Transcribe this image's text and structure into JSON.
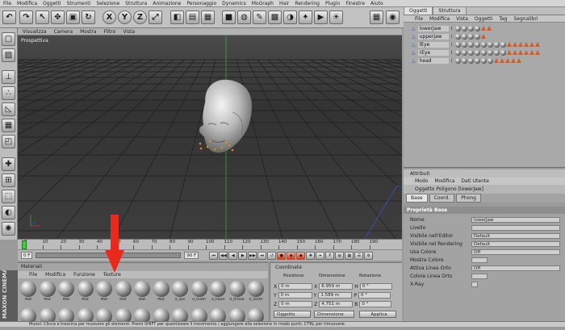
{
  "menubar": {
    "items": [
      "File",
      "Modifica",
      "Oggetti",
      "Strumenti",
      "Selezione",
      "Struttura",
      "Animazione",
      "Personaggio",
      "Dynamics",
      "MoGraph",
      "Hair",
      "Rendering",
      "Plugin",
      "Finestre",
      "Aiuto"
    ]
  },
  "toolbar": {
    "tools": [
      {
        "name": "undo-button",
        "glyph": "↶"
      },
      {
        "name": "redo-button",
        "glyph": "↷"
      },
      {
        "name": "select-tool-button",
        "glyph": "↖"
      },
      {
        "name": "move-tool-button",
        "glyph": "✥"
      },
      {
        "name": "scale-tool-button",
        "glyph": "▣"
      },
      {
        "name": "rotate-tool-button",
        "glyph": "↻"
      },
      {
        "name": "x-axis-button",
        "glyph": "X"
      },
      {
        "name": "y-axis-button",
        "glyph": "Y"
      },
      {
        "name": "z-axis-button",
        "glyph": "Z"
      },
      {
        "name": "coord-system-button",
        "glyph": "⤢"
      },
      {
        "name": "render-view-button",
        "glyph": "◧"
      },
      {
        "name": "render-picture-viewer-button",
        "glyph": "▤"
      },
      {
        "name": "render-settings-button",
        "glyph": "▦"
      },
      {
        "name": "cube-button",
        "glyph": "■"
      },
      {
        "name": "nurbs-button",
        "glyph": "◍"
      },
      {
        "name": "spline-button",
        "glyph": "✎"
      },
      {
        "name": "array-button",
        "glyph": "▩"
      },
      {
        "name": "deformer-button",
        "glyph": "◑"
      },
      {
        "name": "scene-button",
        "glyph": "✦"
      },
      {
        "name": "camera-button",
        "glyph": "▶"
      },
      {
        "name": "light-button",
        "glyph": "☀"
      }
    ],
    "right_tools": [
      {
        "name": "layout-button",
        "glyph": "▦"
      },
      {
        "name": "head-icon-button",
        "glyph": "◉"
      }
    ]
  },
  "left_tools": [
    {
      "name": "object-mode-button",
      "glyph": "▢"
    },
    {
      "name": "texture-mode-button",
      "glyph": "▨"
    },
    {
      "name": "axis-mode-button",
      "glyph": "⊥"
    },
    {
      "name": "points-mode-button",
      "glyph": "∴"
    },
    {
      "name": "edges-mode-button",
      "glyph": "◺"
    },
    {
      "name": "polygons-mode-button",
      "glyph": "▦"
    },
    {
      "name": "uv-mode-button",
      "glyph": "◰"
    },
    {
      "name": "snap-button",
      "glyph": "✚"
    },
    {
      "name": "workplane-button",
      "glyph": "⊞"
    },
    {
      "name": "tweak-button",
      "glyph": "⬚"
    },
    {
      "name": "sculpt-button",
      "glyph": "◐"
    },
    {
      "name": "brush-button",
      "glyph": "✺"
    }
  ],
  "viewport": {
    "menu": [
      "Visualizza",
      "Camera",
      "Mostra",
      "Filtro",
      "Vista"
    ],
    "label": "Prospettiva"
  },
  "right_tabs": [
    "Oggetti",
    "Struttura"
  ],
  "objects_menu": [
    "File",
    "Modifica",
    "Vista",
    "Oggetti",
    "Tag",
    "Segnalibri"
  ],
  "objects": [
    {
      "name": "lowerJaw",
      "balls": 4,
      "tris": 2
    },
    {
      "name": "upperJaw",
      "balls": 4,
      "tris": 1
    },
    {
      "name": "lEye",
      "balls": 8,
      "tris": 6
    },
    {
      "name": "rEye",
      "balls": 8,
      "tris": 6
    },
    {
      "name": "head",
      "balls": 6,
      "tris": 5
    }
  ],
  "attributes": {
    "title": "Attributi",
    "menu": [
      "Modo",
      "Modifica",
      "Dati Utente"
    ],
    "object_label": "Oggetto Poligono [lowerJaw]",
    "tabs": [
      "Base",
      "Coord.",
      "Phong"
    ],
    "section": "Proprietà Base",
    "rows": [
      {
        "label": "Nome",
        "value": "lowerJaw"
      },
      {
        "label": "Livello",
        "value": ""
      },
      {
        "label": "Visibile nell'Editor",
        "value": "Default"
      },
      {
        "label": "Visibile nel Rendering",
        "value": "Default"
      },
      {
        "label": "Usa Colore",
        "value": "Off"
      },
      {
        "label": "Mostra Colore",
        "value": ""
      },
      {
        "label": "Attiva Linea Orto",
        "value": "Off"
      },
      {
        "label": "Colore Linea Orto",
        "value": ""
      },
      {
        "label": "X-Ray",
        "value": ""
      }
    ]
  },
  "timeline": {
    "ticks": [
      "0",
      "10",
      "20",
      "30",
      "40",
      "50",
      "60",
      "70",
      "80",
      "90",
      "100",
      "110",
      "120",
      "130",
      "140",
      "150",
      "160",
      "170",
      "180",
      "190"
    ],
    "current_frame": "0 F",
    "start_frame": "0 F",
    "end_frame": "90 F",
    "fps": "90 F"
  },
  "materials": {
    "title": "Materiali",
    "menu": [
      "File",
      "Modifica",
      "Funzione",
      "Texture"
    ],
    "row1": [
      "Mat",
      "Mat",
      "Mat",
      "Mat",
      "Mat",
      "Mat",
      "Mat",
      "Mat",
      "d_lips",
      "d_tooth",
      "d_head",
      "d_throat",
      "d_teeth"
    ],
    "row2_count": 13
  },
  "coords": {
    "title": "Coordinate",
    "headers": [
      "Posizione",
      "Dimensione",
      "Rotazione"
    ],
    "rows": [
      {
        "axis": "X",
        "pos": "0 m",
        "dim": "6.959 m",
        "rotlabel": "H",
        "rot": "0 °"
      },
      {
        "axis": "Y",
        "pos": "0 m",
        "dim": "1.589 m",
        "rotlabel": "P",
        "rot": "0 °"
      },
      {
        "axis": "Z",
        "pos": "0 m",
        "dim": "4.751 m",
        "rotlabel": "B",
        "rot": "0 °"
      }
    ],
    "mode1": "Oggetto",
    "mode2": "Dimensione",
    "apply": "Applica"
  },
  "status": "Muovi: Clicca e trascina per muovere gli elementi. Premi SHIFT per quantizzare il movimento / aggiungere alla selezione in modo punti, CTRL per rimuovere.",
  "brand": "MAXON CINEMA 4D",
  "colors": {
    "accent": "#e8291c",
    "viewport_bg": "#3b3b3b",
    "grid": "#1c1c1c",
    "y_axis": "#2fae3a"
  }
}
